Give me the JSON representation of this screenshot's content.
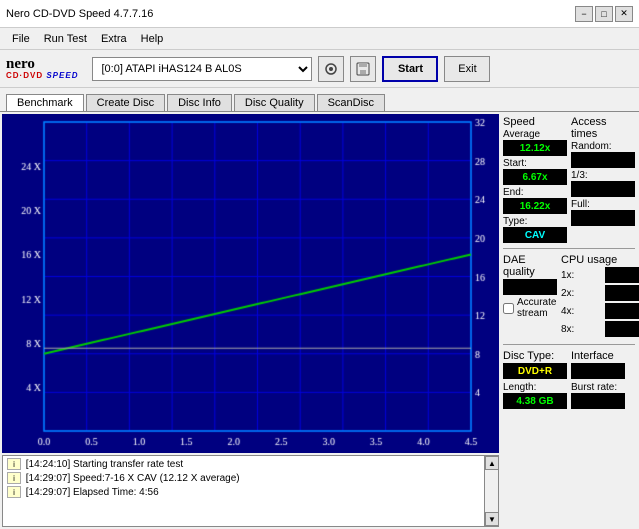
{
  "title_bar": {
    "title": "Nero CD-DVD Speed 4.7.7.16",
    "minimize_label": "−",
    "maximize_label": "□",
    "close_label": "✕"
  },
  "menu": {
    "items": [
      "File",
      "Run Test",
      "Extra",
      "Help"
    ]
  },
  "toolbar": {
    "drive_value": "[0:0]  ATAPI iHAS124  B AL0S",
    "start_label": "Start",
    "exit_label": "Exit"
  },
  "tabs": {
    "items": [
      "Benchmark",
      "Create Disc",
      "Disc Info",
      "Disc Quality",
      "ScanDisc"
    ],
    "active": 0
  },
  "stats": {
    "speed_title": "Speed",
    "average_label": "Average",
    "average_value": "12.12x",
    "start_label": "Start:",
    "start_value": "6.67x",
    "end_label": "End:",
    "end_value": "16.22x",
    "type_label": "Type:",
    "type_value": "CAV",
    "dae_title": "DAE quality",
    "dae_value": "",
    "accurate_stream_label": "Accurate stream",
    "disc_type_title": "Disc Type:",
    "disc_type_value": "DVD+R",
    "length_label": "Length:",
    "length_value": "4.38 GB",
    "access_title": "Access times",
    "random_label": "Random:",
    "random_value": "",
    "one_third_label": "1/3:",
    "one_third_value": "",
    "full_label": "Full:",
    "full_value": "",
    "cpu_title": "CPU usage",
    "cpu_1x_label": "1x:",
    "cpu_1x_value": "",
    "cpu_2x_label": "2x:",
    "cpu_2x_value": "",
    "cpu_4x_label": "4x:",
    "cpu_4x_value": "",
    "cpu_8x_label": "8x:",
    "cpu_8x_value": "",
    "interface_label": "Interface",
    "burst_label": "Burst rate:"
  },
  "log": {
    "lines": [
      "[14:24:10]  Starting transfer rate test",
      "[14:29:07]  Speed:7-16 X CAV (12.12 X average)",
      "[14:29:07]  Elapsed Time: 4:56"
    ]
  },
  "chart": {
    "y_left_labels": [
      "24 X",
      "20 X",
      "16 X",
      "12 X",
      "8 X",
      "4 X"
    ],
    "y_right_labels": [
      "32",
      "28",
      "24",
      "20",
      "16",
      "12",
      "8",
      "4"
    ],
    "x_labels": [
      "0.0",
      "0.5",
      "1.0",
      "1.5",
      "2.0",
      "2.5",
      "3.0",
      "3.5",
      "4.0",
      "4.5"
    ]
  },
  "colors": {
    "chart_bg": "#000080",
    "grid_line": "#0000cc",
    "speed_line": "#00cc00",
    "access_line": "#ffffff",
    "accent": "#00ff00",
    "highlight": "#00ffff"
  }
}
